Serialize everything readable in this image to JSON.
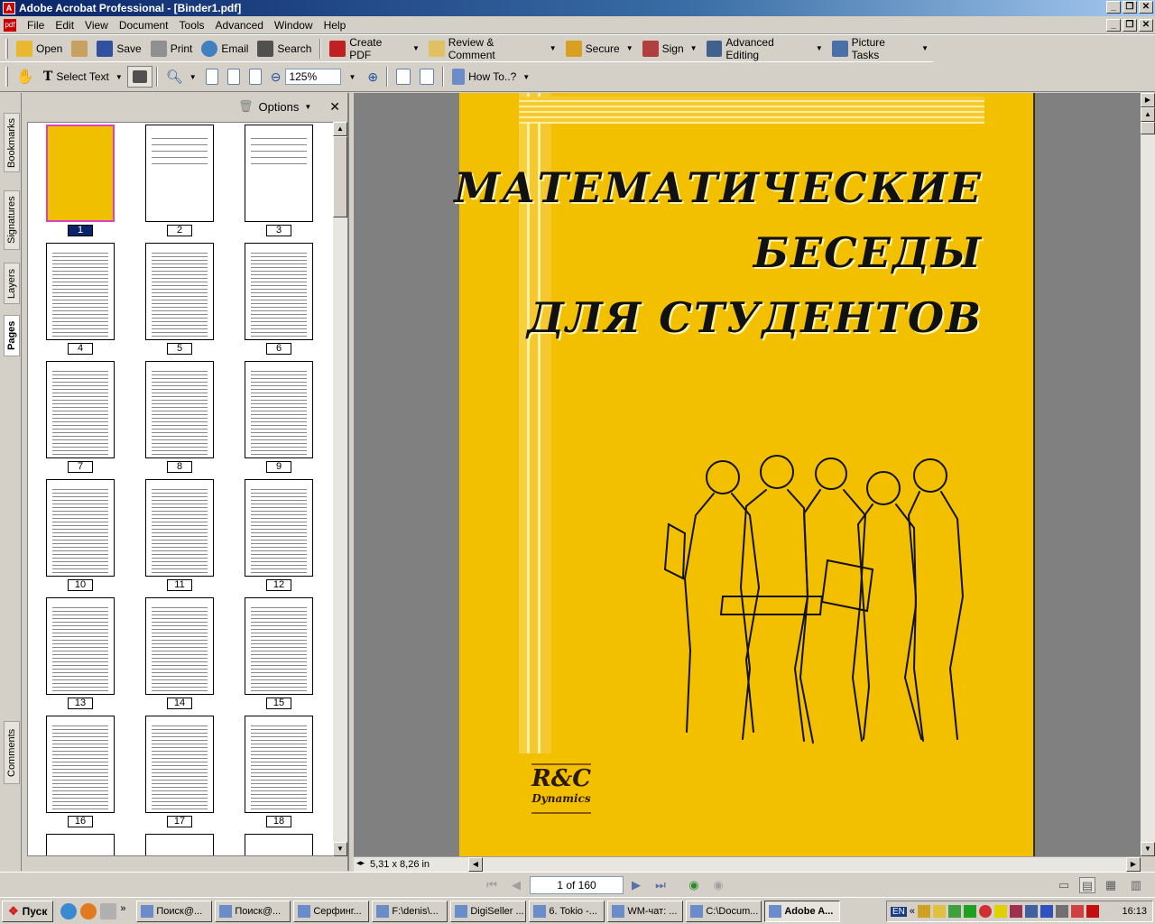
{
  "window": {
    "title": "Adobe Acrobat Professional - [Binder1.pdf]"
  },
  "menu": [
    "File",
    "Edit",
    "View",
    "Document",
    "Tools",
    "Advanced",
    "Window",
    "Help"
  ],
  "toolbar1": {
    "open": "Open",
    "save": "Save",
    "print": "Print",
    "email": "Email",
    "search": "Search",
    "create_pdf": "Create PDF",
    "review": "Review & Comment",
    "secure": "Secure",
    "sign": "Sign",
    "advanced_editing": "Advanced Editing",
    "picture_tasks": "Picture Tasks"
  },
  "toolbar2": {
    "select_text": "Select Text",
    "zoom": "125%",
    "how_to": "How To..?"
  },
  "side_tabs": [
    "Bookmarks",
    "Signatures",
    "Layers",
    "Pages",
    "Comments"
  ],
  "pages_panel": {
    "options": "Options",
    "thumb_labels": [
      "1",
      "2",
      "3",
      "4",
      "5",
      "6",
      "7",
      "8",
      "9",
      "10",
      "11",
      "12",
      "13",
      "14",
      "15",
      "16",
      "17",
      "18"
    ]
  },
  "cover": {
    "line1": "МАТЕМАТИЧЕСКИЕ",
    "line2": "БЕСЕДЫ",
    "line3": "ДЛЯ СТУДЕНТОВ",
    "logo_main": "R&C",
    "logo_sub": "Dynamics",
    "bg_color": "#f3c000"
  },
  "status": {
    "page_size": "5,31 x 8,26 in",
    "page_field": "1 of 160"
  },
  "taskbar": {
    "start": "Пуск",
    "tasks": [
      "Поиск@...",
      "Поиск@...",
      "Серфинг...",
      "F:\\denis\\...",
      "DigiSeller ...",
      "6. Tokio -...",
      "WM-чат: ...",
      "C:\\Docum...",
      "Adobe A..."
    ],
    "lang": "EN",
    "clock": "16:13"
  }
}
